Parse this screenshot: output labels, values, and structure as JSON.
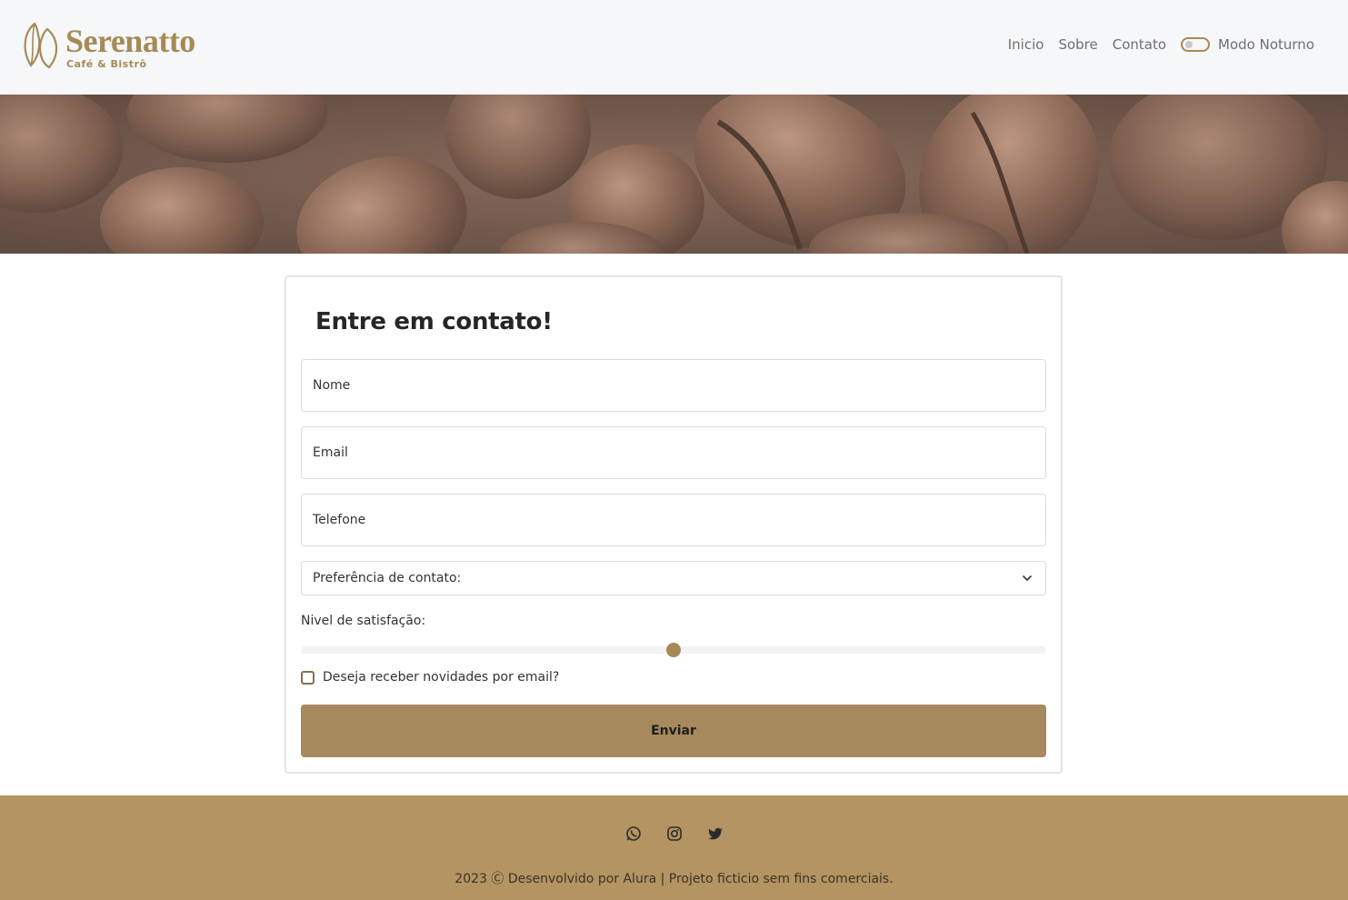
{
  "brand": {
    "name": "Serenatto",
    "tagline": "Café & Bistrô",
    "color": "#a68a56"
  },
  "nav": {
    "items": [
      {
        "label": "Inicio"
      },
      {
        "label": "Sobre"
      },
      {
        "label": "Contato"
      }
    ],
    "dark_mode_label": "Modo Noturno",
    "dark_mode_on": false
  },
  "banner": {
    "icon": "coffee-beans-image"
  },
  "form": {
    "title": "Entre em contato!",
    "name_placeholder": "Nome",
    "email_placeholder": "Email",
    "phone_placeholder": "Telefone",
    "contact_preference": "Preferência de contato:",
    "satisfaction_label": "Nivel de satisfação:",
    "satisfaction_value": 0.5,
    "newsletter_label": "Deseja receber novidades por email?",
    "newsletter_checked": false,
    "submit_label": "Enviar",
    "accent_color": "#a68a5d"
  },
  "footer": {
    "social_icons": [
      "whatsapp-icon",
      "instagram-icon",
      "twitter-icon"
    ],
    "copyright": "2023 Ⓒ Desenvolvido por Alura | Projeto ficticio sem fins comerciais.",
    "background": "#b39462"
  }
}
